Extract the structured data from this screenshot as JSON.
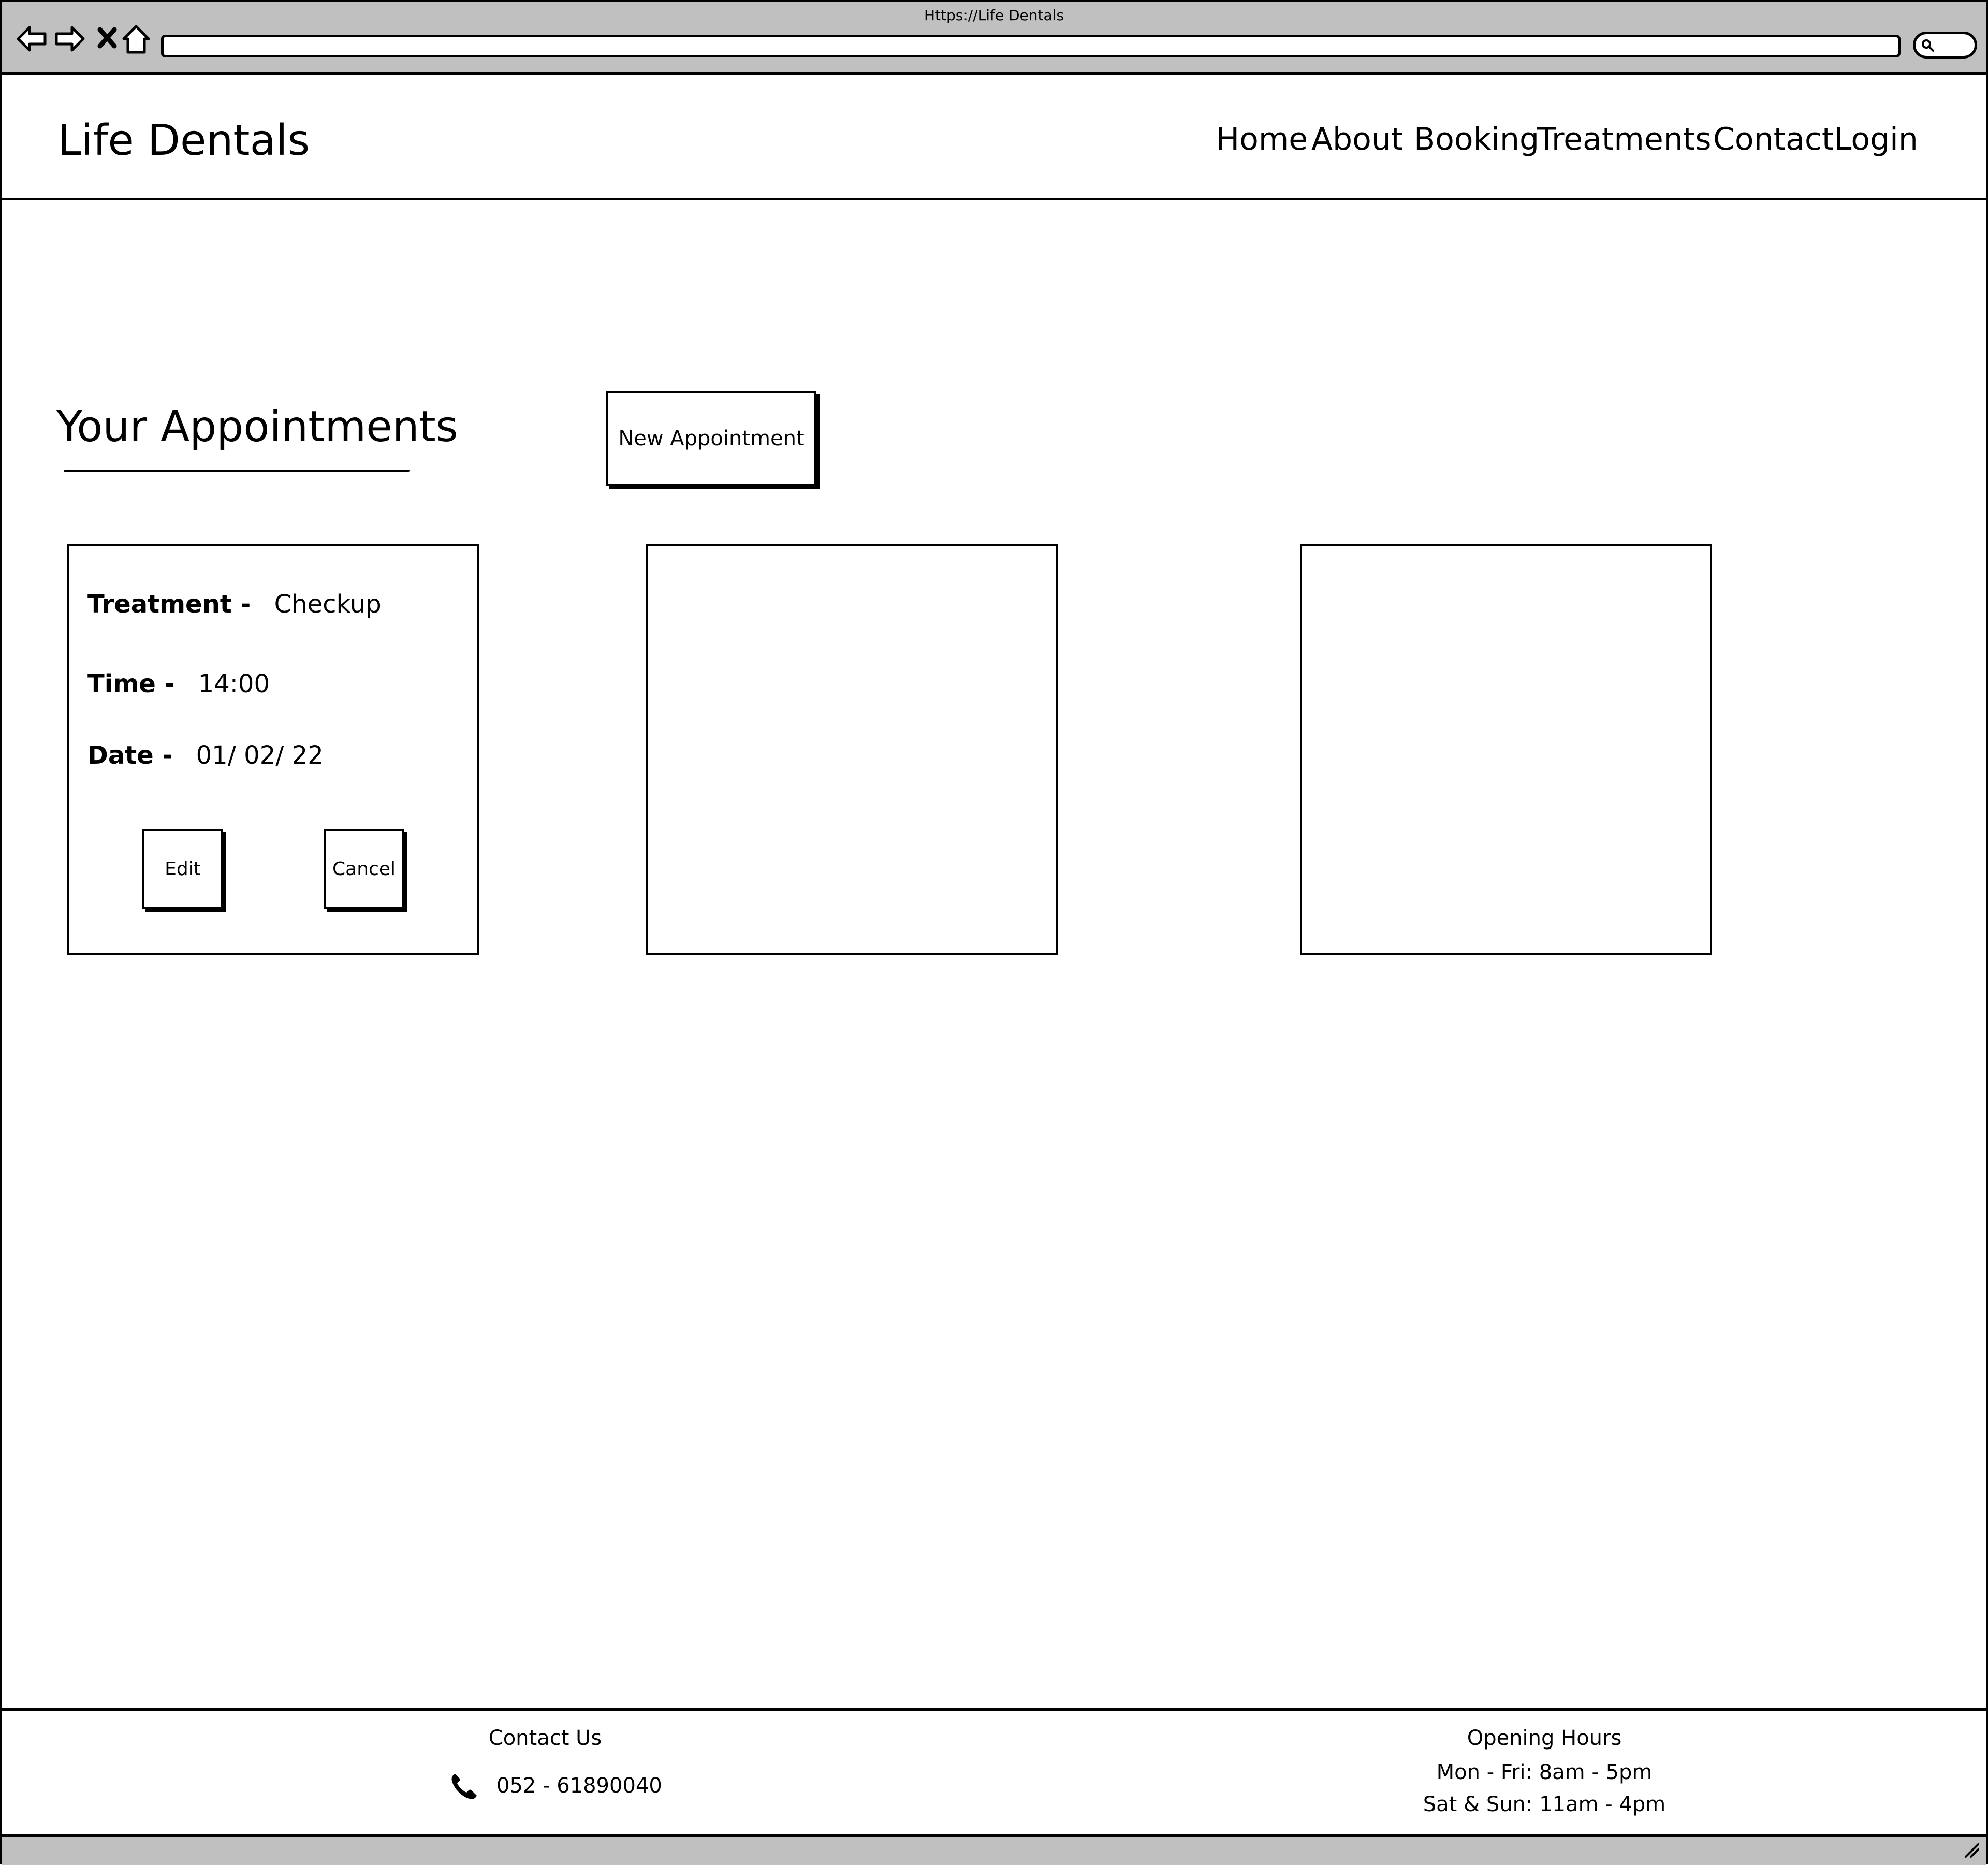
{
  "browser": {
    "title": "Https://Life Dentals",
    "address": ""
  },
  "header": {
    "logo": "Life Dentals",
    "nav": [
      "Home",
      "About",
      "Booking",
      "Treatments",
      "Contact",
      "Login"
    ]
  },
  "main": {
    "title": "Your Appointments",
    "new_button": "New Appointment",
    "appointment": {
      "treatment_label": "Treatment -",
      "treatment_value": "Checkup",
      "time_label": "Time -",
      "time_value": "14:00",
      "date_label": "Date -",
      "date_value": "01/ 02/ 22",
      "edit_label": "Edit",
      "cancel_label": "Cancel"
    }
  },
  "footer": {
    "contact_title": "Contact Us",
    "phone": "052 - 61890040",
    "hours_title": "Opening Hours",
    "hours_weekday": "Mon - Fri: 8am - 5pm",
    "hours_weekend": "Sat & Sun: 11am - 4pm"
  },
  "icons": {
    "back": "back-arrow-icon",
    "forward": "forward-arrow-icon",
    "stop": "close-icon",
    "home": "home-icon",
    "search": "search-icon",
    "phone": "phone-icon"
  }
}
